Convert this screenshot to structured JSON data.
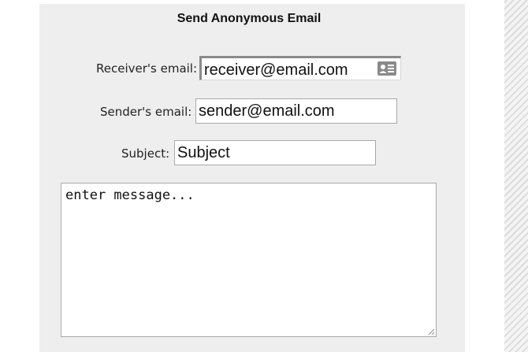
{
  "form": {
    "title": "Send Anonymous Email",
    "receiver": {
      "label": "Receiver's email:",
      "value": "receiver@email.com",
      "icon": "contact-card-icon"
    },
    "sender": {
      "label": "Sender's email:",
      "value": "sender@email.com"
    },
    "subject": {
      "label": "Subject:",
      "value": "Subject"
    },
    "message": {
      "value": "enter message..."
    }
  },
  "colors": {
    "panel_background": "#eeeeee",
    "field_border": "#a9a9a9",
    "focused_border": "#8a8a8a",
    "stripe": "#dcdcdc"
  }
}
